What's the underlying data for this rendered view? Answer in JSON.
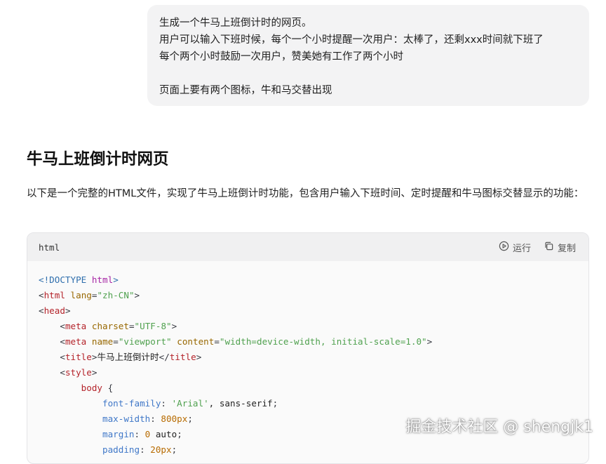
{
  "user_message": {
    "lines": [
      "生成一个牛马上班倒计时的网页。",
      "用户可以输入下班时候，每个一个小时提醒一次用户：太棒了，还剩xxx时间就下班了",
      "每个两个小时鼓励一次用户，赞美她有工作了两个小时",
      "",
      "页面上要有两个图标，牛和马交替出现"
    ]
  },
  "answer": {
    "title": "牛马上班倒计时网页",
    "intro": "以下是一个完整的HTML文件，实现了牛马上班倒计时功能，包含用户输入下班时间、定时提醒和牛马图标交替显示的功能："
  },
  "code_block": {
    "language": "html",
    "run_label": "运行",
    "copy_label": "复制",
    "run_icon": "play-circle-icon",
    "copy_icon": "copy-icon",
    "lines": [
      "<!DOCTYPE html>",
      "<html lang=\"zh-CN\">",
      "<head>",
      "    <meta charset=\"UTF-8\">",
      "    <meta name=\"viewport\" content=\"width=device-width, initial-scale=1.0\">",
      "    <title>牛马上班倒计时</title>",
      "    <style>",
      "        body {",
      "            font-family: 'Arial', sans-serif;",
      "            max-width: 800px;",
      "            margin: 0 auto;",
      "            padding: 20px;"
    ]
  },
  "watermark": "掘金技术社区 @ shengjk1"
}
